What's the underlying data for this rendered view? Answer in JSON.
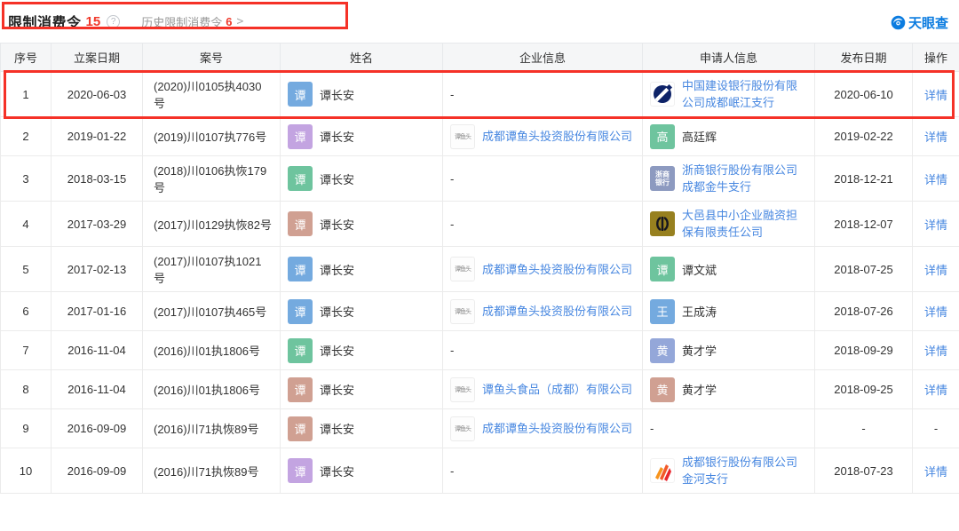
{
  "header": {
    "title": "限制消费令",
    "count": "15",
    "help_glyph": "?",
    "history_label": "历史限制消费令",
    "history_count": "6",
    "chevron": ">"
  },
  "brand": {
    "name": "天眼查"
  },
  "colors": {
    "count_red": "#f0392b",
    "annotation_red": "#f53127",
    "link_blue": "#4787e0",
    "brand_blue": "#0b7ce0"
  },
  "logos": {
    "tyt": {
      "label": "谭鱼头",
      "name": "tanyutou-company-logo"
    },
    "zs": {
      "label_line1": "浙商",
      "label_line2": "银行",
      "color": "#8d9ac0",
      "name": "zheshang-bank-logo"
    },
    "ccb": {
      "color": "#0e2368",
      "name": "ccb-bank-logo"
    },
    "dy": {
      "color": "#97801f",
      "glyph_color": "#16161f",
      "name": "dayi-guarantee-logo"
    },
    "cd": {
      "colors": [
        "#f7941d",
        "#f2592a",
        "#e8262d"
      ],
      "name": "bank-of-chengdu-logo"
    }
  },
  "table": {
    "headers": [
      "序号",
      "立案日期",
      "案号",
      "姓名",
      "企业信息",
      "申请人信息",
      "发布日期",
      "操作"
    ],
    "detail_label": "详情",
    "dash": "-",
    "rows": [
      {
        "no": "1",
        "filing_date": "2020-06-03",
        "case_no": "(2020)川0105执4030号",
        "name": {
          "char": "谭",
          "color": "#74aadf",
          "text": "谭长安"
        },
        "company": null,
        "applicant": {
          "kind": "company",
          "logo": "ccb",
          "text": "中国建设银行股份有限公司成都岷江支行"
        },
        "publish_date": "2020-06-10",
        "action": "详情",
        "highlighted": true
      },
      {
        "no": "2",
        "filing_date": "2019-01-22",
        "case_no": "(2019)川0107执776号",
        "name": {
          "char": "谭",
          "color": "#c3a4e1",
          "text": "谭长安"
        },
        "company": {
          "logo": "tyt",
          "text": "成都谭鱼头投资股份有限公司"
        },
        "applicant": {
          "kind": "person",
          "char": "高",
          "color": "#6ec49e",
          "text": "高廷辉"
        },
        "publish_date": "2019-02-22",
        "action": "详情",
        "highlighted": false
      },
      {
        "no": "3",
        "filing_date": "2018-03-15",
        "case_no": "(2018)川0106执恢179号",
        "name": {
          "char": "谭",
          "color": "#6ec49e",
          "text": "谭长安"
        },
        "company": null,
        "applicant": {
          "kind": "company",
          "logo": "zs",
          "text": "浙商银行股份有限公司成都金牛支行"
        },
        "publish_date": "2018-12-21",
        "action": "详情",
        "highlighted": false
      },
      {
        "no": "4",
        "filing_date": "2017-03-29",
        "case_no": "(2017)川0129执恢82号",
        "name": {
          "char": "谭",
          "color": "#d0a092",
          "text": "谭长安"
        },
        "company": null,
        "applicant": {
          "kind": "company",
          "logo": "dy",
          "text": "大邑县中小企业融资担保有限责任公司"
        },
        "publish_date": "2018-12-07",
        "action": "详情",
        "highlighted": false
      },
      {
        "no": "5",
        "filing_date": "2017-02-13",
        "case_no": "(2017)川0107执1021号",
        "name": {
          "char": "谭",
          "color": "#74aadf",
          "text": "谭长安"
        },
        "company": {
          "logo": "tyt",
          "text": "成都谭鱼头投资股份有限公司"
        },
        "applicant": {
          "kind": "person",
          "char": "谭",
          "color": "#6ec49e",
          "text": "谭文斌"
        },
        "publish_date": "2018-07-25",
        "action": "详情",
        "highlighted": false
      },
      {
        "no": "6",
        "filing_date": "2017-01-16",
        "case_no": "(2017)川0107执465号",
        "name": {
          "char": "谭",
          "color": "#74aadf",
          "text": "谭长安"
        },
        "company": {
          "logo": "tyt",
          "text": "成都谭鱼头投资股份有限公司"
        },
        "applicant": {
          "kind": "person",
          "char": "王",
          "color": "#74aadf",
          "text": "王成涛"
        },
        "publish_date": "2018-07-26",
        "action": "详情",
        "highlighted": false
      },
      {
        "no": "7",
        "filing_date": "2016-11-04",
        "case_no": "(2016)川01执1806号",
        "name": {
          "char": "谭",
          "color": "#6ec49e",
          "text": "谭长安"
        },
        "company": null,
        "applicant": {
          "kind": "person",
          "char": "黄",
          "color": "#94a7d9",
          "text": "黄才学"
        },
        "publish_date": "2018-09-29",
        "action": "详情",
        "highlighted": false
      },
      {
        "no": "8",
        "filing_date": "2016-11-04",
        "case_no": "(2016)川01执1806号",
        "name": {
          "char": "谭",
          "color": "#d0a092",
          "text": "谭长安"
        },
        "company": {
          "logo": "tyt",
          "text": "谭鱼头食品（成都）有限公司"
        },
        "applicant": {
          "kind": "person",
          "char": "黄",
          "color": "#d0a092",
          "text": "黄才学"
        },
        "publish_date": "2018-09-25",
        "action": "详情",
        "highlighted": false
      },
      {
        "no": "9",
        "filing_date": "2016-09-09",
        "case_no": "(2016)川71执恢89号",
        "name": {
          "char": "谭",
          "color": "#d0a092",
          "text": "谭长安"
        },
        "company": {
          "logo": "tyt",
          "text": "成都谭鱼头投资股份有限公司"
        },
        "applicant": null,
        "publish_date": "-",
        "action": "-",
        "highlighted": false
      },
      {
        "no": "10",
        "filing_date": "2016-09-09",
        "case_no": "(2016)川71执恢89号",
        "name": {
          "char": "谭",
          "color": "#c3a4e1",
          "text": "谭长安"
        },
        "company": null,
        "applicant": {
          "kind": "company",
          "logo": "cd",
          "text": "成都银行股份有限公司金河支行"
        },
        "publish_date": "2018-07-23",
        "action": "详情",
        "highlighted": false
      }
    ]
  }
}
